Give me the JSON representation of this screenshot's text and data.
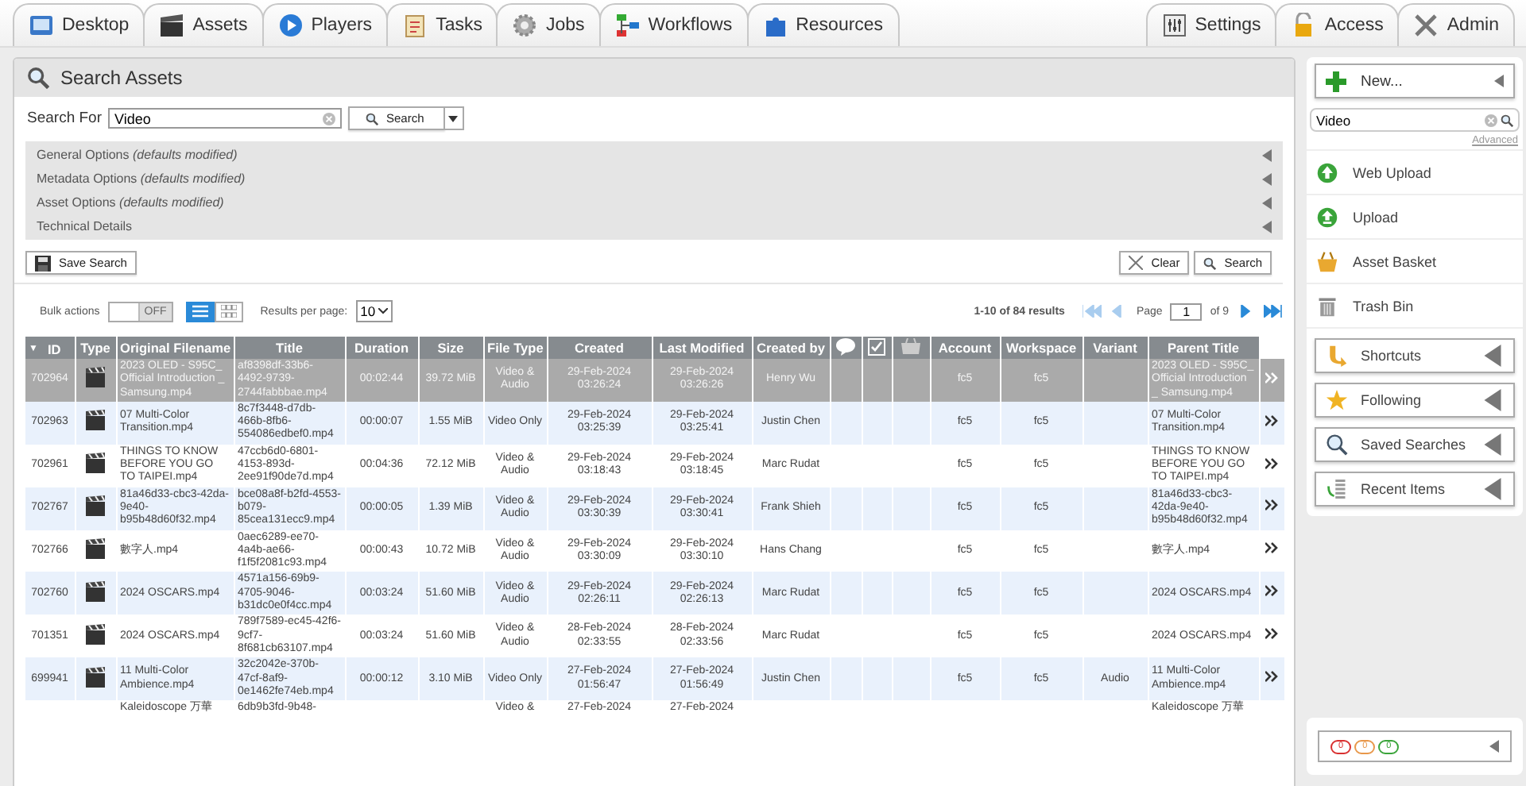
{
  "nav_tabs": [
    {
      "label": "Desktop"
    },
    {
      "label": "Assets"
    },
    {
      "label": "Players"
    },
    {
      "label": "Tasks"
    },
    {
      "label": "Jobs"
    },
    {
      "label": "Workflows"
    },
    {
      "label": "Resources"
    }
  ],
  "right_tabs": [
    {
      "label": "Settings"
    },
    {
      "label": "Access"
    },
    {
      "label": "Admin"
    }
  ],
  "panel": {
    "title": "Search Assets",
    "search_label": "Search For",
    "search_value": "Video",
    "search_button": "Search"
  },
  "options": [
    "General Options *(defaults modified)*",
    "Metadata Options *(defaults modified)*",
    "Asset Options *(defaults modified)*",
    "Technical Details"
  ],
  "buttons": {
    "save": "Save Search",
    "clear": "Clear",
    "search": "Search"
  },
  "bulk_actions": {
    "label": "Bulk actions",
    "on": false,
    "state_text": "OFF"
  },
  "view_modes": [
    {
      "kind": "list",
      "selected": true
    },
    {
      "kind": "grid",
      "selected": false
    }
  ],
  "results_per_page": {
    "label": "Results per page:",
    "value": "10"
  },
  "pager": {
    "summary": "1-10 of 84 results",
    "page_label": "Page",
    "page": "1",
    "of": "of 9"
  },
  "table": {
    "columns": [
      {
        "kind": "text",
        "label": "ID",
        "sort_mark": "▼"
      },
      {
        "kind": "text",
        "label": "Type"
      },
      {
        "kind": "text",
        "label": "Original Filename"
      },
      {
        "kind": "text",
        "label": "Title"
      },
      {
        "kind": "text",
        "label": "Duration"
      },
      {
        "kind": "text",
        "label": "Size"
      },
      {
        "kind": "text",
        "label": "File Type"
      },
      {
        "kind": "text",
        "label": "Created"
      },
      {
        "kind": "text",
        "label": "Last Modified"
      },
      {
        "kind": "text",
        "label": "Created by"
      },
      {
        "kind": "comment"
      },
      {
        "kind": "check"
      },
      {
        "kind": "basket"
      },
      {
        "kind": "text",
        "label": "Account"
      },
      {
        "kind": "text",
        "label": "Workspace"
      },
      {
        "kind": "text",
        "label": "Variant"
      },
      {
        "kind": "text",
        "label": "Parent Title"
      }
    ],
    "rows": [
      {
        "selected": true,
        "id": "702964",
        "filename": "2023 OLED - S95C_ Official Introduction _ Samsung.mp4",
        "title": "af8398df-33b6-4492-9739-2744fabbbae.mp4",
        "duration": "00:02:44",
        "size": "39.72 MiB",
        "file_type": "Video & Audio",
        "created": "29-Feb-2024 03:26:24",
        "modified": "29-Feb-2024 03:26:26",
        "created_by": "Henry Wu",
        "account": "fc5",
        "workspace": "fc5",
        "parent_title": "2023 OLED - S95C_ Official Introduction _ Samsung.mp4"
      },
      {
        "selected": false,
        "id": "702963",
        "filename": "07 Multi-Color Transition.mp4",
        "title": "8c7f3448-d7db-466b-8fb6-554086edbef0.mp4",
        "duration": "00:00:07",
        "size": "1.55 MiB",
        "file_type": "Video Only",
        "created": "29-Feb-2024 03:25:39",
        "modified": "29-Feb-2024 03:25:41",
        "created_by": "Justin Chen",
        "account": "fc5",
        "workspace": "fc5",
        "parent_title": "07 Multi-Color Transition.mp4"
      },
      {
        "selected": false,
        "id": "702961",
        "filename": "THINGS TO KNOW BEFORE YOU GO TO TAIPEI.mp4",
        "title": "47ccb6d0-6801-4153-893d-2ee91f90de7d.mp4",
        "duration": "00:04:36",
        "size": "72.12 MiB",
        "file_type": "Video & Audio",
        "created": "29-Feb-2024 03:18:43",
        "modified": "29-Feb-2024 03:18:45",
        "created_by": "Marc Rudat",
        "account": "fc5",
        "workspace": "fc5",
        "parent_title": "THINGS TO KNOW BEFORE YOU GO TO TAIPEI.mp4"
      },
      {
        "selected": false,
        "id": "702767",
        "filename": "81a46d33-cbc3-42da-9e40-b95b48d60f32.mp4",
        "title": "bce08a8f-b2fd-4553-b079-85cea131ecc9.mp4",
        "duration": "00:00:05",
        "size": "1.39 MiB",
        "file_type": "Video & Audio",
        "created": "29-Feb-2024 03:30:39",
        "modified": "29-Feb-2024 03:30:41",
        "created_by": "Frank Shieh",
        "account": "fc5",
        "workspace": "fc5",
        "parent_title": "81a46d33-cbc3-42da-9e40-b95b48d60f32.mp4"
      },
      {
        "selected": false,
        "id": "702766",
        "filename": "數字人.mp4",
        "title": "0aec6289-ee70-4a4b-ae66-f1f5f2081c93.mp4",
        "duration": "00:00:43",
        "size": "10.72 MiB",
        "file_type": "Video & Audio",
        "created": "29-Feb-2024 03:30:09",
        "modified": "29-Feb-2024 03:30:10",
        "created_by": "Hans Chang",
        "account": "fc5",
        "workspace": "fc5",
        "parent_title": "數字人.mp4"
      },
      {
        "selected": false,
        "id": "702760",
        "filename": "2024 OSCARS.mp4",
        "title": "4571a156-69b9-4705-9046-b31dc0e0f4cc.mp4",
        "duration": "00:03:24",
        "size": "51.60 MiB",
        "file_type": "Video & Audio",
        "created": "29-Feb-2024 02:26:11",
        "modified": "29-Feb-2024 02:26:13",
        "created_by": "Marc Rudat",
        "account": "fc5",
        "workspace": "fc5",
        "parent_title": "2024 OSCARS.mp4"
      },
      {
        "selected": false,
        "id": "701351",
        "filename": "2024 OSCARS.mp4",
        "title": "789f7589-ec45-42f6-9cf7-8f681cb63107.mp4",
        "duration": "00:03:24",
        "size": "51.60 MiB",
        "file_type": "Video & Audio",
        "created": "28-Feb-2024 02:33:55",
        "modified": "28-Feb-2024 02:33:56",
        "created_by": "Marc Rudat",
        "account": "fc5",
        "workspace": "fc5",
        "parent_title": "2024 OSCARS.mp4"
      },
      {
        "selected": false,
        "id": "699941",
        "filename": "11 Multi-Color Ambience.mp4",
        "title": "32c2042e-370b-47cf-8af9-0e1462fe74eb.mp4",
        "duration": "00:00:12",
        "size": "3.10 MiB",
        "file_type": "Video Only",
        "created": "27-Feb-2024 01:56:47",
        "modified": "27-Feb-2024 01:56:49",
        "created_by": "Justin Chen",
        "account": "fc5",
        "workspace": "fc5",
        "variant": "Audio",
        "parent_title": "11 Multi-Color Ambience.mp4"
      },
      {
        "selected": false,
        "filename": "Kaleidoscope 万華",
        "title": "6db9b3fd-9b48-",
        "file_type": "Video &",
        "created": "27-Feb-2024",
        "modified": "27-Feb-2024",
        "parent_title": "Kaleidoscope 万華"
      }
    ]
  },
  "sidebar": {
    "new_button": "New...",
    "search_value": "Video",
    "advanced_link": "Advanced",
    "actions": [
      {
        "kind": "web_upload",
        "label": "Web Upload"
      },
      {
        "kind": "upload",
        "label": "Upload"
      },
      {
        "kind": "basket",
        "label": "Asset Basket"
      },
      {
        "kind": "trash",
        "label": "Trash Bin"
      }
    ],
    "sections": [
      {
        "kind": "shortcuts",
        "label": "Shortcuts"
      },
      {
        "kind": "following",
        "label": "Following"
      },
      {
        "kind": "saved",
        "label": "Saved Searches"
      },
      {
        "kind": "recent",
        "label": "Recent Items"
      }
    ],
    "counters": [
      {
        "value": "0",
        "color": "#d93030"
      },
      {
        "value": "0",
        "color": "#e8974a"
      },
      {
        "value": "0",
        "color": "#3aa43a"
      }
    ]
  }
}
